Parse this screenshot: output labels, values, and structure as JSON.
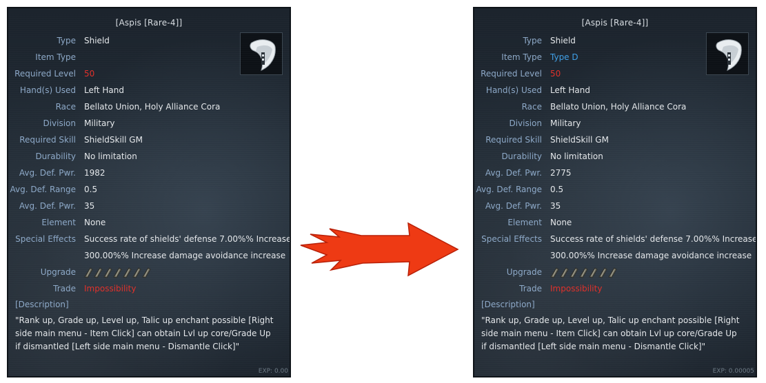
{
  "panels": [
    {
      "title": "[Aspis [Rare-4]]",
      "rows": [
        {
          "label": "Type",
          "value": "Shield"
        },
        {
          "label": "Item Type",
          "value": ""
        },
        {
          "label": "Required Level",
          "value": "50"
        },
        {
          "label": "Hand(s) Used",
          "value": "Left Hand"
        },
        {
          "label": "Race",
          "value": "Bellato Union, Holy Alliance Cora"
        },
        {
          "label": "Division",
          "value": "Military"
        },
        {
          "label": "Required Skill",
          "value": "ShieldSkill GM"
        },
        {
          "label": "Durability",
          "value": "No limitation"
        },
        {
          "label": "Avg. Def. Pwr.",
          "value": "1982"
        },
        {
          "label": "Avg. Def. Range",
          "value": "0.5"
        },
        {
          "label": "Avg. Def. Pwr.",
          "value": "35"
        },
        {
          "label": "Element",
          "value": "None"
        },
        {
          "label": "Special Effects",
          "value": "Success rate of shields' defense 7.00%% Increase"
        },
        {
          "label": "",
          "value": "300.00%% Increase damage avoidance increase"
        },
        {
          "label": "Upgrade",
          "value": ""
        },
        {
          "label": "Trade",
          "value": "Impossibility"
        }
      ],
      "description_heading": "[Description]",
      "description": "\"Rank up, Grade up, Level up, Talic up enchant possible [Right side main menu - Item Click] can obtain Lvl up core/Grade Up if dismantled [Left side main menu - Dismantle Click]\"",
      "bg_exp": "EXP: 0.00"
    },
    {
      "title": "[Aspis [Rare-4]]",
      "rows": [
        {
          "label": "Type",
          "value": "Shield"
        },
        {
          "label": "Item Type",
          "value": "Type D"
        },
        {
          "label": "Required Level",
          "value": "50"
        },
        {
          "label": "Hand(s) Used",
          "value": "Left Hand"
        },
        {
          "label": "Race",
          "value": "Bellato Union, Holy Alliance Cora"
        },
        {
          "label": "Division",
          "value": "Military"
        },
        {
          "label": "Required Skill",
          "value": "ShieldSkill GM"
        },
        {
          "label": "Durability",
          "value": "No limitation"
        },
        {
          "label": "Avg. Def. Pwr.",
          "value": "2775"
        },
        {
          "label": "Avg. Def. Range",
          "value": "0.5"
        },
        {
          "label": "Avg. Def. Pwr.",
          "value": "35"
        },
        {
          "label": "Element",
          "value": "None"
        },
        {
          "label": "Special Effects",
          "value": "Success rate of shields' defense 7.00%% Increase"
        },
        {
          "label": "",
          "value": "300.00%% Increase damage avoidance increase"
        },
        {
          "label": "Upgrade",
          "value": ""
        },
        {
          "label": "Trade",
          "value": "Impossibility"
        }
      ],
      "description_heading": "[Description]",
      "description": "\"Rank up, Grade up, Level up, Talic up enchant possible [Right side main menu - Item Click] can obtain Lvl up core/Grade Up if dismantled [Left side main menu - Dismantle Click]\"",
      "bg_exp": "EXP: 0.00005"
    }
  ],
  "colors": {
    "label": "#8da9c8",
    "value": "#e4e7ea",
    "red": "#e0302a",
    "blue": "#3f9fe6",
    "arrow": "#ee3a14"
  },
  "icons": {
    "item": "shield-icon",
    "upgrade_slot": "talic-slot-icon",
    "arrow": "arrow-right-icon"
  },
  "upgrade_slots": 7
}
